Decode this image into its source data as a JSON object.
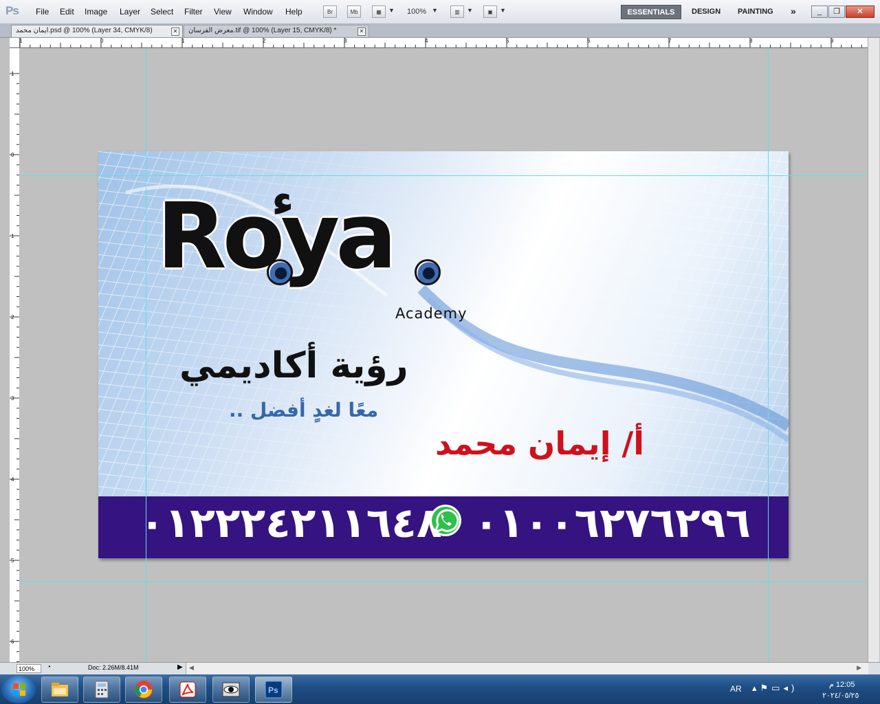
{
  "app": {
    "logo": "Ps"
  },
  "menu": [
    "File",
    "Edit",
    "Image",
    "Layer",
    "Select",
    "Filter",
    "View",
    "Window",
    "Help"
  ],
  "toolbar": {
    "bridge": "Br",
    "minibridge": "Mb",
    "zoom": "100%"
  },
  "workspaces": {
    "essentials": "ESSENTIALS",
    "design": "DESIGN",
    "painting": "PAINTING",
    "more": "»"
  },
  "tabs": [
    {
      "label": "ايمان محمد.psd @ 100% (Layer 34, CMYK/8)"
    },
    {
      "label": "معرض الفرسان.tif @ 100% (Layer 15, CMYK/8) *"
    }
  ],
  "ruler": {
    "h": [
      "1",
      "0",
      "1",
      "2",
      "3",
      "4",
      "5",
      "6",
      "7",
      "8",
      "9"
    ],
    "v": [
      "1",
      "0",
      "1",
      "2",
      "3",
      "4",
      "5",
      "6"
    ]
  },
  "card": {
    "logo_word": "Roya",
    "logo_hamza": "ء",
    "logo_sub": "Academy",
    "arabic_name": "رؤية أكاديمي",
    "slogan": "معًا لغدٍ أفضل ..",
    "teacher": "أ/ إيمان محمد",
    "phone_1": "٠١٢٢٢٤٢١١٦٤٨",
    "phone_2": "٠١٠٠٦٢٧٦٢٩٦",
    "band_color": "#351380",
    "name_color": "#d0101c"
  },
  "status": {
    "zoom": "100%",
    "doc": "Doc: 2.26M/8.41M"
  },
  "taskbar": {
    "apps": [
      "explorer",
      "calculator",
      "chrome",
      "acrobat",
      "eye-viewer",
      "photoshop"
    ],
    "lang": "AR",
    "time": "12:05 م",
    "date": "٢٠٢٤/٠٥/٢٥"
  }
}
